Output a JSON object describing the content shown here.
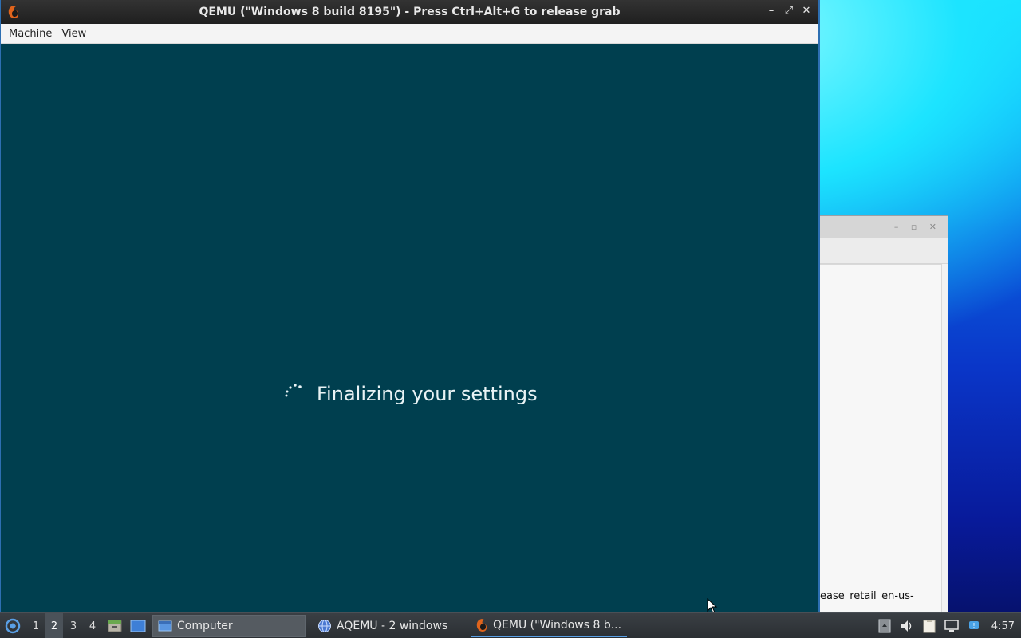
{
  "qemu_window": {
    "title": "QEMU (\"Windows 8 build 8195\") - Press Ctrl+Alt+G to release grab",
    "menu": [
      "Machine",
      "View"
    ],
    "vm_status_text": "Finalizing your settings"
  },
  "background_window": {
    "visible_text": "ease_retail_en-us-"
  },
  "taskbar": {
    "workspaces": [
      "1",
      "2",
      "3",
      "4"
    ],
    "active_workspace": "2",
    "tasks": [
      {
        "label": "Computer",
        "icon": "computer-folder-icon"
      },
      {
        "label": "AQEMU - 2 windows",
        "icon": "aqemu-globe-icon"
      },
      {
        "label": "QEMU (\"Windows 8 b...",
        "icon": "qemu-icon"
      }
    ],
    "tray_icons": [
      "storage-icon",
      "volume-icon",
      "clipboard-icon",
      "display-icon",
      "network-icon"
    ],
    "clock": "4:57"
  },
  "colors": {
    "vm_background": "#003f4f",
    "title_bar": "#2a2a2a",
    "taskbar": "#2f3438",
    "accent": "#5aa0e6"
  }
}
